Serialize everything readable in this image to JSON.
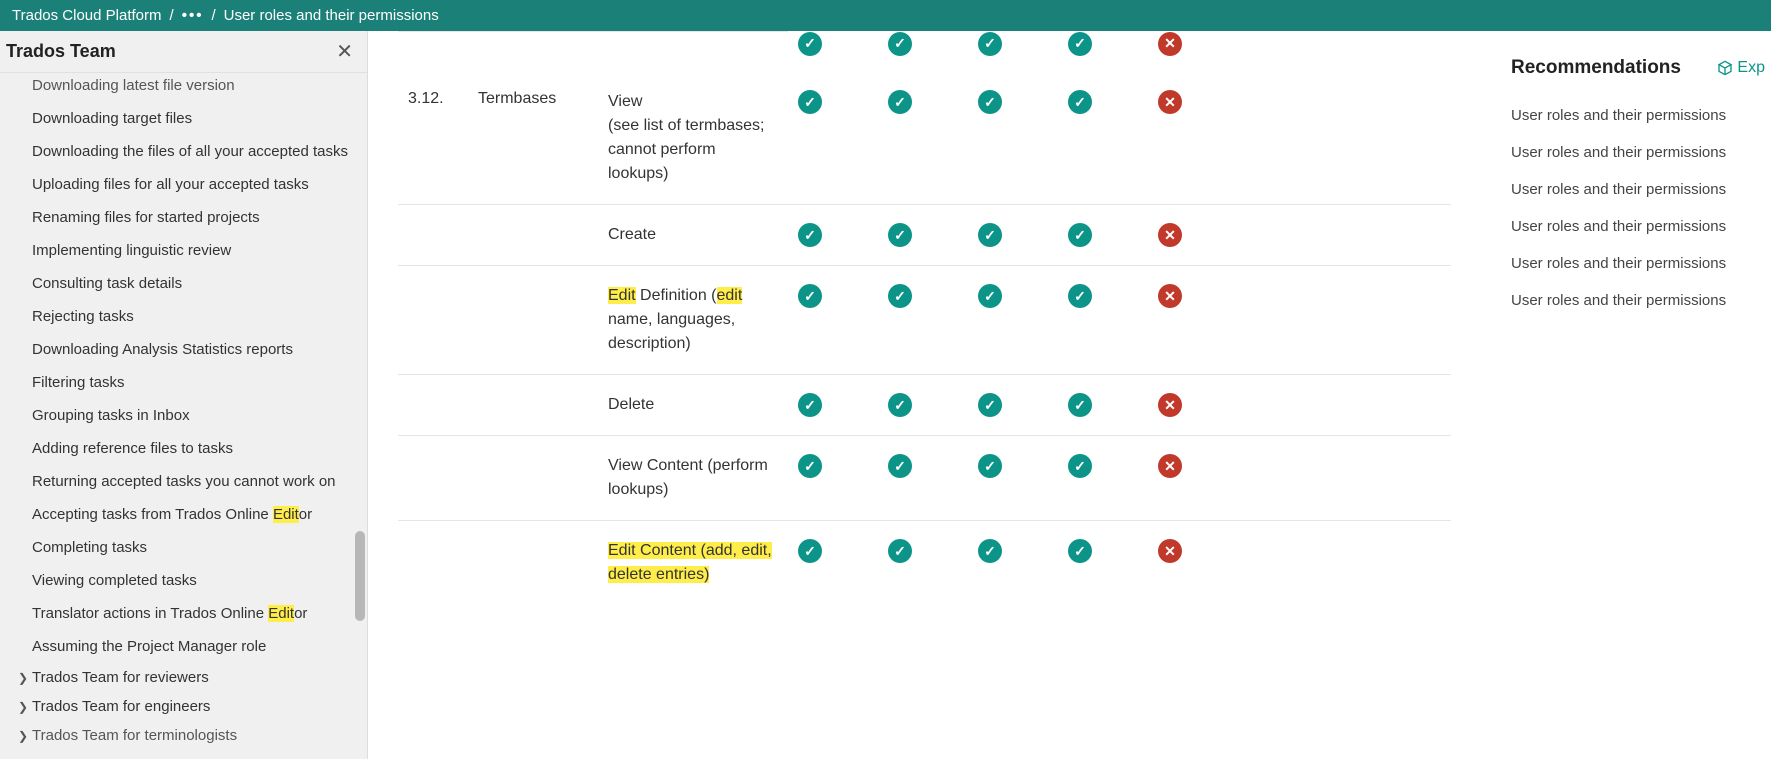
{
  "breadcrumb": {
    "root": "Trados Cloud Platform",
    "dots": "•••",
    "page": "User roles and their permissions"
  },
  "sidebar": {
    "title": "Trados Team",
    "items": [
      "Downloading latest file version",
      "Downloading target files",
      "Downloading the files of all your accepted tasks",
      "Uploading files for all your accepted tasks",
      "Renaming files for started projects",
      "Implementing linguistic review",
      "Consulting task details",
      "Rejecting tasks",
      "Downloading Analysis Statistics reports",
      "Filtering tasks",
      "Grouping tasks in Inbox",
      "Adding reference files to tasks",
      "Returning accepted tasks you cannot work on",
      "Accepting tasks from Trados Online |Edit|or",
      "Completing tasks",
      "Viewing completed tasks",
      "Translator actions in Trados Online |Edit|or",
      "Assuming the Project Manager role"
    ],
    "groups": [
      "Trados Team for reviewers",
      "Trados Team for engineers",
      "Trados Team for terminologists"
    ]
  },
  "table": {
    "section_num": "3.12.",
    "section": "Termbases",
    "rows": [
      {
        "desc": "View\n(see list of termbases; cannot perform lookups)",
        "perms": [
          "y",
          "y",
          "y",
          "y",
          "n"
        ]
      },
      {
        "desc": "Create",
        "perms": [
          "y",
          "y",
          "y",
          "y",
          "n"
        ]
      },
      {
        "desc": "|Edit| Definition (|edit| name, languages, description)",
        "perms": [
          "y",
          "y",
          "y",
          "y",
          "n"
        ]
      },
      {
        "desc": "Delete",
        "perms": [
          "y",
          "y",
          "y",
          "y",
          "n"
        ]
      },
      {
        "desc": "View Content (perform lookups)",
        "perms": [
          "y",
          "y",
          "y",
          "y",
          "n"
        ]
      },
      {
        "desc": "HLBLOCK:|Edit| Content (add, |edit|, delete entries)",
        "perms": [
          "y",
          "y",
          "y",
          "y",
          "n"
        ]
      }
    ]
  },
  "right": {
    "title": "Recommendations",
    "expand": "Exp",
    "items": [
      "User roles and their permissions",
      "User roles and their permissions",
      "User roles and their permissions",
      "User roles and their permissions",
      "User roles and their permissions",
      "User roles and their permissions"
    ]
  }
}
